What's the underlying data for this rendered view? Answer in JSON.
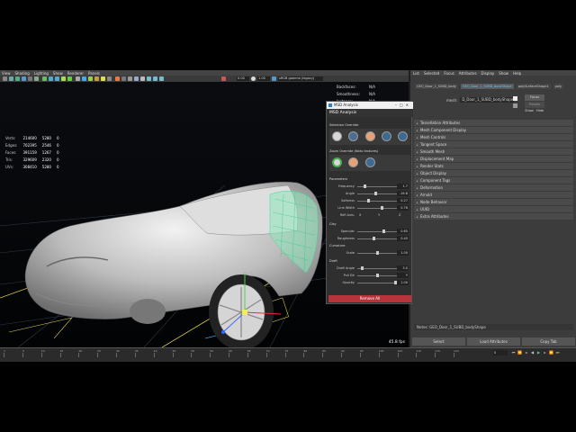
{
  "viewport": {
    "menu": [
      "View",
      "Shading",
      "Lighting",
      "Show",
      "Renderer",
      "Panels"
    ],
    "gamma_field": "0.00",
    "exposure_field": "1.00",
    "color_space": "sRGB gamma (legacy)",
    "hud_stats": [
      {
        "label": "Verts:",
        "a": "214600",
        "b": "5280",
        "c": "0"
      },
      {
        "label": "Edges:",
        "a": "702395",
        "b": "2546",
        "c": "0"
      },
      {
        "label": "Faces:",
        "a": "391159",
        "b": "1267",
        "c": "0"
      },
      {
        "label": "Tris:",
        "a": "329609",
        "b": "2320",
        "c": "0"
      },
      {
        "label": "UVs:",
        "a": "308410",
        "b": "5280",
        "c": "0"
      }
    ],
    "hud_right": [
      {
        "label": "Backfaces:",
        "value": "N/A"
      },
      {
        "label": "Smoothness:",
        "value": "N/A"
      },
      {
        "label": "Instance:",
        "value": "N/A"
      }
    ],
    "fps": "45.8 fps"
  },
  "attribute_editor": {
    "menu": [
      "List",
      "Selected",
      "Focus",
      "Attributes",
      "Display",
      "Show",
      "Help"
    ],
    "tabs": [
      "GEO_Door_1_SUBD_body",
      "GEO_Door_1_SUBD_bodyShape",
      "polySurfaceShape1",
      "poly"
    ],
    "active_tab": 1,
    "mesh_label": "mesh:",
    "mesh_value": "D_Door_1_SUBD_bodyShape",
    "focus_button": "Focus",
    "presets_button": "Presets",
    "show_button": "Show",
    "hide_button": "Hide",
    "sections": [
      "Tessellation Attributes",
      "Mesh Component Display",
      "Mesh Controls",
      "Tangent Space",
      "Smooth Mesh",
      "Displacement Map",
      "Render Stats",
      "Object Display",
      "Component Tags",
      "Deformation",
      "Arnold",
      "Node Behavior",
      "UUID",
      "Extra Attributes"
    ],
    "notes": "Notes: GEO_Door_1_SUBD_bodyShape",
    "select_button": "Select",
    "load_button": "Load Attributes",
    "copy_button": "Copy Tab"
  },
  "msd": {
    "window_title": "MSD Analysis",
    "header": "MSD Analysis",
    "selection_override": "Selection Override",
    "zoom_override": "Zoom Override (folds textures)",
    "parameters_label": "Parameters",
    "params": [
      {
        "label": "Frequency",
        "value": "1.7",
        "pos": 0.18
      },
      {
        "label": "Angle",
        "value": "-16.8",
        "pos": 0.45
      },
      {
        "label": "Softness",
        "value": "0.27",
        "pos": 0.27
      },
      {
        "label": "Line Width",
        "value": "0.78",
        "pos": 0.6
      }
    ],
    "refl_label": "Refl Axis:",
    "refl_x": "X",
    "refl_y": "Y",
    "refl_z": "Z",
    "clay_label": "Clay",
    "clay": [
      {
        "label": "Specular",
        "value": "0.65",
        "pos": 0.65
      },
      {
        "label": "Roughness",
        "value": "0.40",
        "pos": 0.4
      }
    ],
    "curvature_label": "Curvature",
    "curvature": [
      {
        "label": "Scale",
        "value": "1.00",
        "pos": 0.5
      }
    ],
    "draft_label": "Draft",
    "draft": [
      {
        "label": "Draft Angle",
        "value": "3.0",
        "pos": 0.12
      },
      {
        "label": "Pull Dir",
        "value": "Y",
        "pos": 0.5
      },
      {
        "label": "Opacity",
        "value": "1.00",
        "pos": 0.95
      }
    ],
    "remove_button": "Remove All"
  },
  "timeline": {
    "ticks": [
      "1",
      "5",
      "10",
      "15",
      "20",
      "25",
      "30",
      "35",
      "40",
      "45",
      "50",
      "55",
      "60",
      "65",
      "70",
      "75",
      "80",
      "85",
      "90",
      "95",
      "100",
      "105",
      "110",
      "115",
      "120"
    ],
    "current_frame": "0",
    "end_frame": "120"
  }
}
